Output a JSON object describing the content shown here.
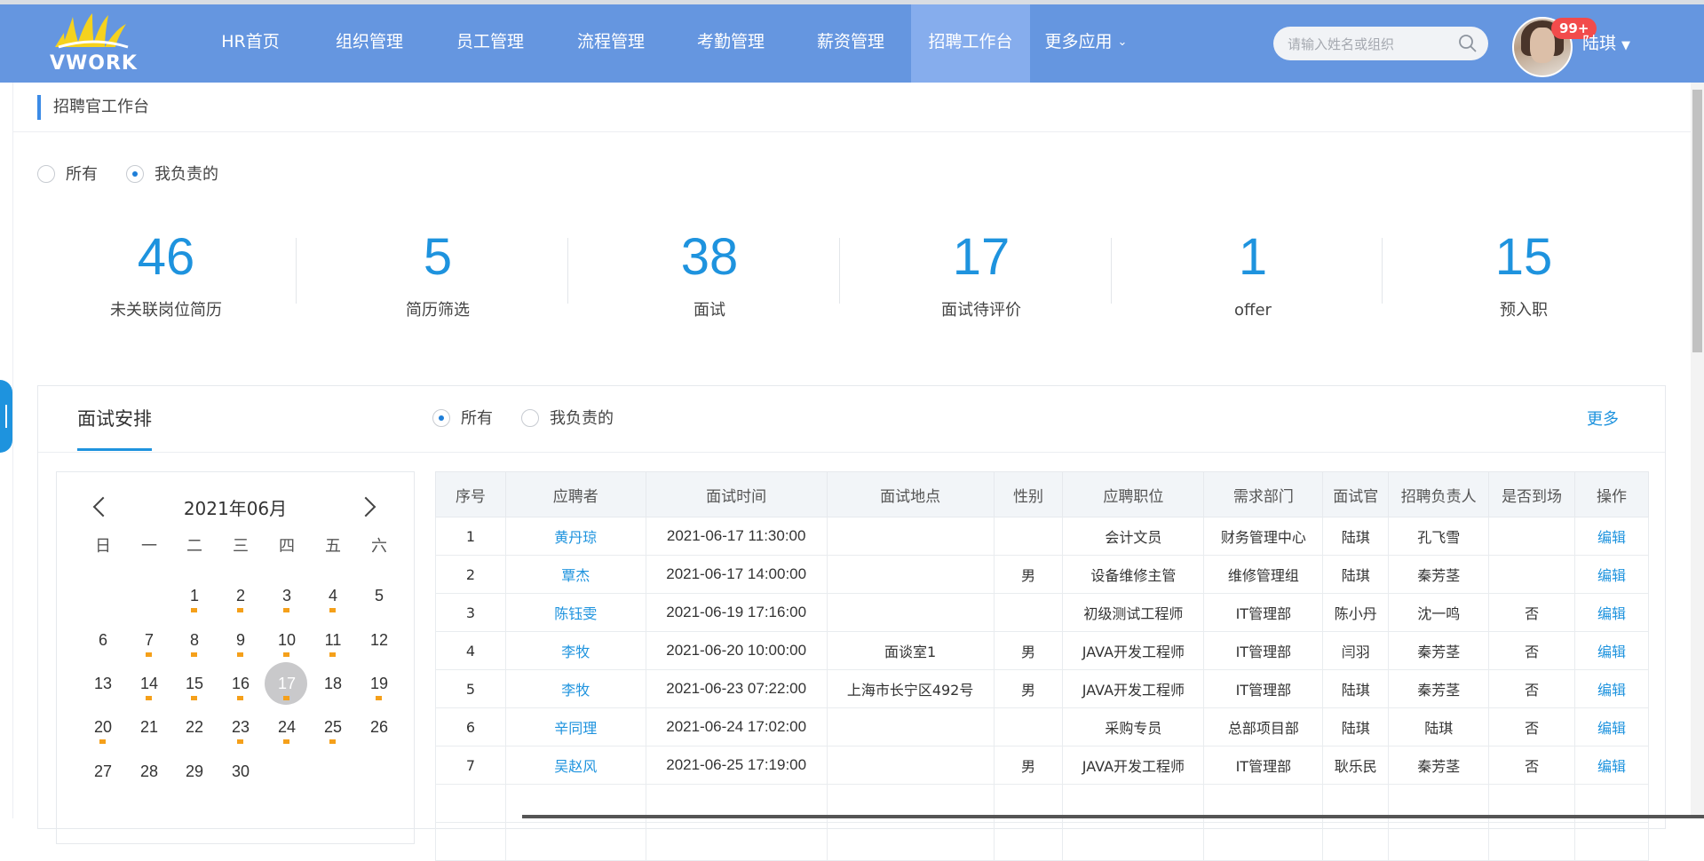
{
  "logo": {
    "text": "VWORK"
  },
  "nav": {
    "items": [
      {
        "label": "HR首页",
        "active": false
      },
      {
        "label": "组织管理",
        "active": false
      },
      {
        "label": "员工管理",
        "active": false
      },
      {
        "label": "流程管理",
        "active": false
      },
      {
        "label": "考勤管理",
        "active": false
      },
      {
        "label": "薪资管理",
        "active": false
      },
      {
        "label": "招聘工作台",
        "active": true
      },
      {
        "label": "更多应用",
        "active": false
      }
    ],
    "more_caret": "⌄"
  },
  "search": {
    "placeholder": "请输入姓名或组织"
  },
  "user": {
    "name": "陆琪",
    "badge": "99+",
    "caret": "▼"
  },
  "breadcrumb": {
    "title": "招聘官工作台"
  },
  "filter_top": {
    "all": "所有",
    "mine": "我负责的",
    "selected": "mine"
  },
  "stats": [
    {
      "value": "46",
      "label": "未关联岗位简历"
    },
    {
      "value": "5",
      "label": "简历筛选"
    },
    {
      "value": "38",
      "label": "面试"
    },
    {
      "value": "17",
      "label": "面试待评价"
    },
    {
      "value": "1",
      "label": "offer"
    },
    {
      "value": "15",
      "label": "预入职"
    }
  ],
  "panel": {
    "title": "面试安排",
    "filter": {
      "all": "所有",
      "mine": "我负责的",
      "selected": "all"
    },
    "more": "更多"
  },
  "calendar": {
    "title": "2021年06月",
    "weekdays": [
      "日",
      "一",
      "二",
      "三",
      "四",
      "五",
      "六"
    ],
    "days": [
      "1",
      "2",
      "3",
      "4",
      "5",
      "6",
      "7",
      "8",
      "9",
      "10",
      "11",
      "12",
      "13",
      "14",
      "15",
      "16",
      "17",
      "18",
      "19",
      "20",
      "21",
      "22",
      "23",
      "24",
      "25",
      "26",
      "27",
      "28",
      "29",
      "30"
    ],
    "today": "17",
    "marked": [
      "1",
      "2",
      "3",
      "4",
      "7",
      "8",
      "9",
      "10",
      "11",
      "14",
      "15",
      "16",
      "17",
      "19",
      "20",
      "23",
      "24",
      "25"
    ]
  },
  "table": {
    "headers": [
      "序号",
      "应聘者",
      "面试时间",
      "面试地点",
      "性别",
      "应聘职位",
      "需求部门",
      "面试官",
      "招聘负责人",
      "是否到场",
      "操作"
    ],
    "rows": [
      [
        "1",
        "黄丹琼",
        "2021-06-17 11:30:00",
        "",
        "",
        "会计文员",
        "财务管理中心",
        "陆琪",
        "孔飞雪",
        "",
        "编辑"
      ],
      [
        "2",
        "覃杰",
        "2021-06-17 14:00:00",
        "",
        "男",
        "设备维修主管",
        "维修管理组",
        "陆琪",
        "秦芳茎",
        "",
        "编辑"
      ],
      [
        "3",
        "陈钰雯",
        "2021-06-19 17:16:00",
        "",
        "",
        "初级测试工程师",
        "IT管理部",
        "陈小丹",
        "沈一鸣",
        "否",
        "编辑"
      ],
      [
        "4",
        "李牧",
        "2021-06-20 10:00:00",
        "面谈室1",
        "男",
        "JAVA开发工程师",
        "IT管理部",
        "闫羽",
        "秦芳茎",
        "否",
        "编辑"
      ],
      [
        "5",
        "李牧",
        "2021-06-23 07:22:00",
        "上海市长宁区492号",
        "男",
        "JAVA开发工程师",
        "IT管理部",
        "陆琪",
        "秦芳茎",
        "否",
        "编辑"
      ],
      [
        "6",
        "辛同理",
        "2021-06-24 17:02:00",
        "",
        "",
        "采购专员",
        "总部项目部",
        "陆琪",
        "陆琪",
        "否",
        "编辑"
      ],
      [
        "7",
        "吴赵风",
        "2021-06-25 17:19:00",
        "",
        "男",
        "JAVA开发工程师",
        "IT管理部",
        "耿乐民",
        "秦芳茎",
        "否",
        "编辑"
      ]
    ]
  }
}
